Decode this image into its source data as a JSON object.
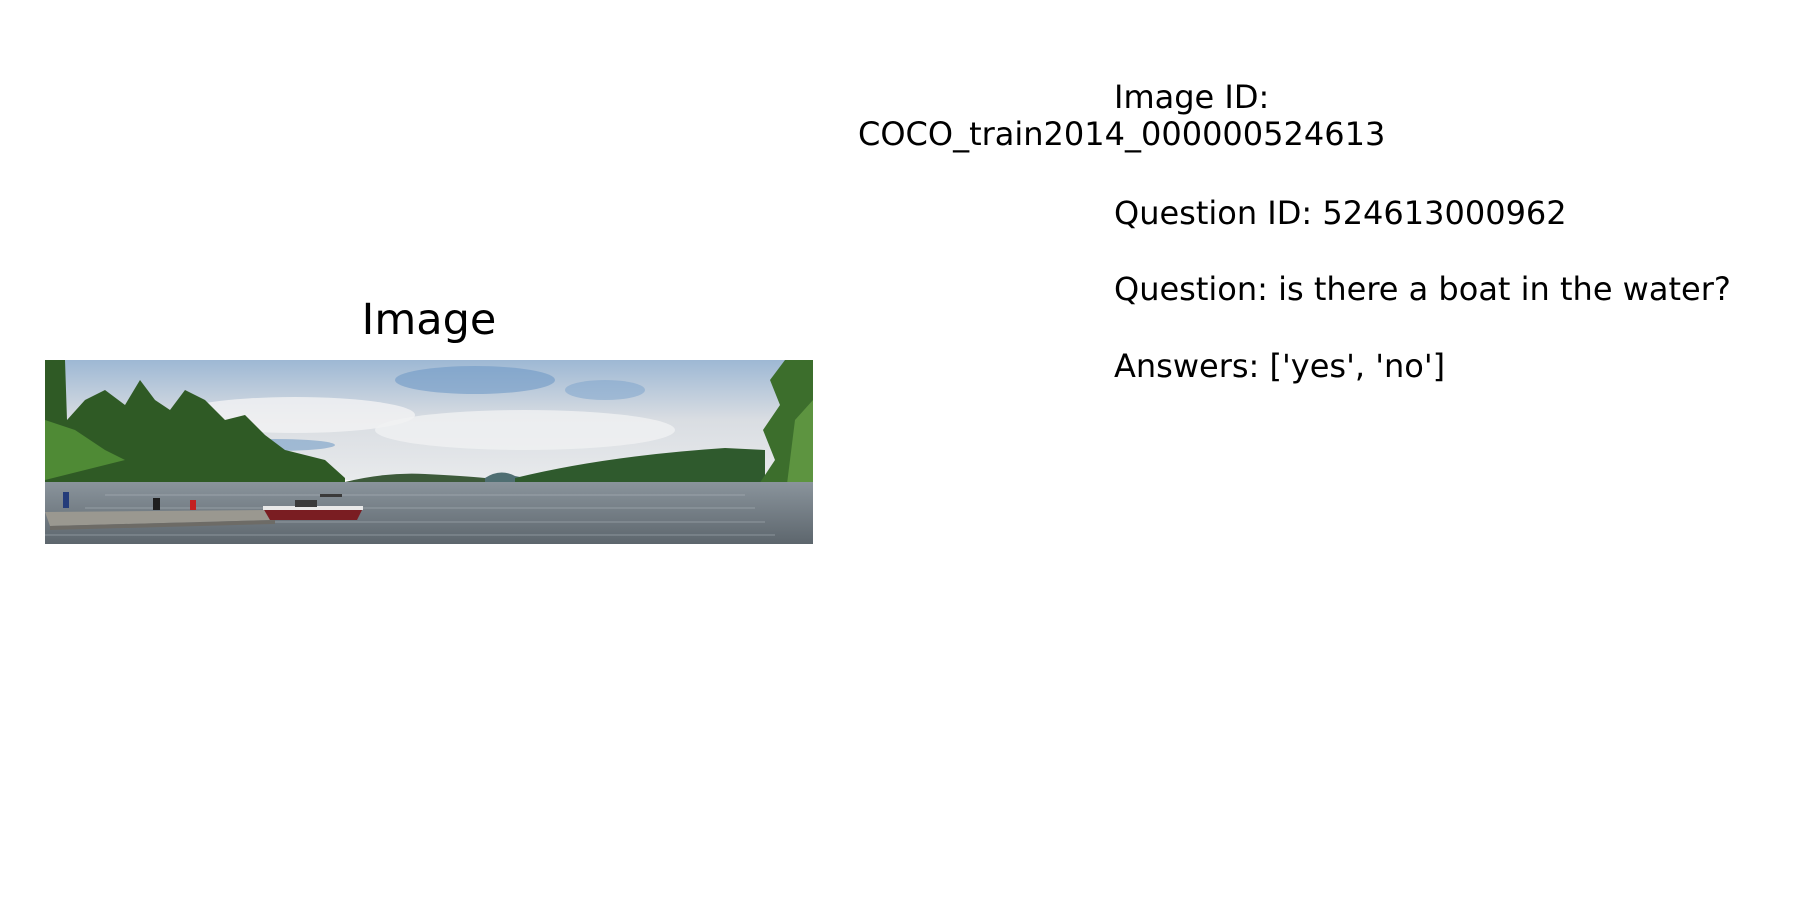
{
  "panel": {
    "title": "Image"
  },
  "photo": {
    "subject": "lake-panorama-with-boat-and-dock"
  },
  "info": {
    "image_id_label": "Image ID:",
    "image_id_value": "COCO_train2014_000000524613",
    "question_id": "Question ID: 524613000962",
    "question": "Question: is there a boat in the water?",
    "answers": "Answers: ['yes', 'no']"
  }
}
